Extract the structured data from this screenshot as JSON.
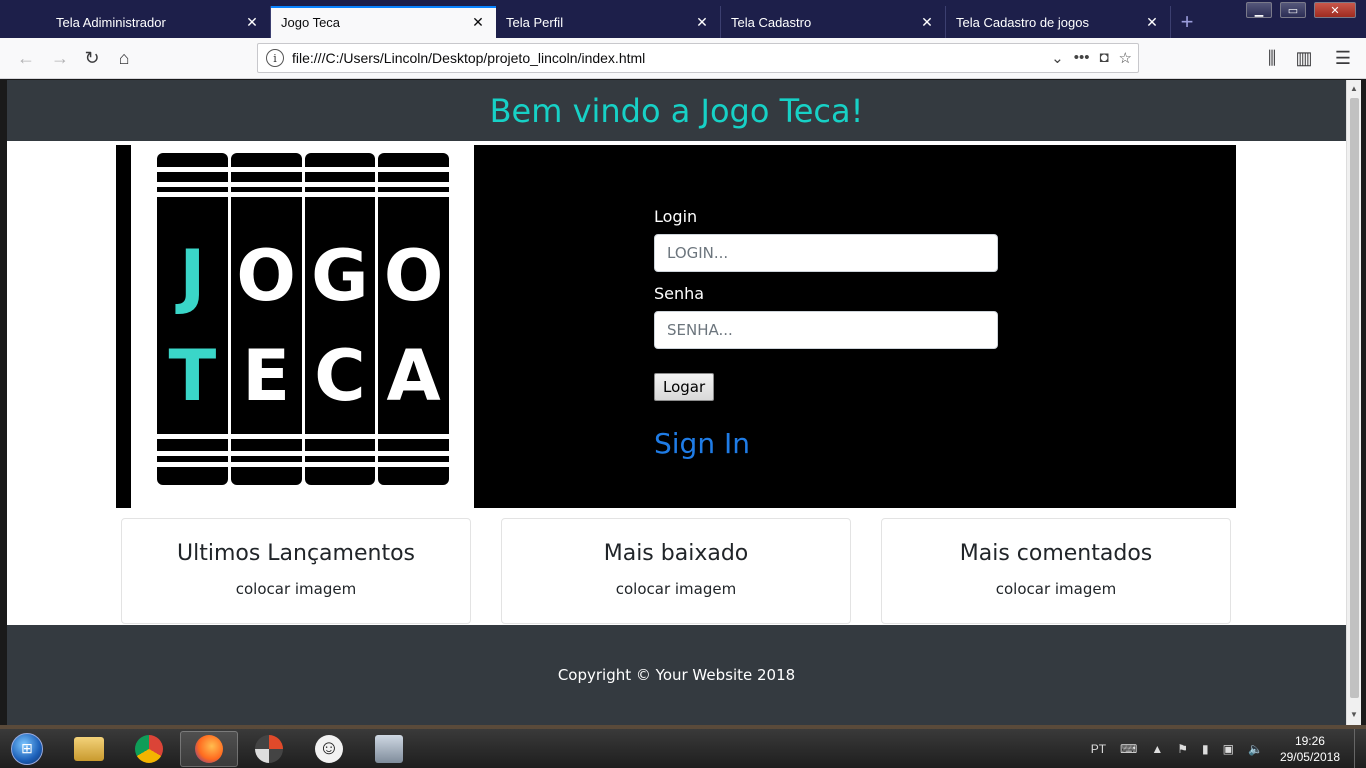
{
  "browser": {
    "tabs": [
      {
        "title": "Tela Adiministrador",
        "active": false
      },
      {
        "title": "Jogo Teca",
        "active": true
      },
      {
        "title": "Tela Perfil",
        "active": false
      },
      {
        "title": "Tela Cadastro",
        "active": false
      },
      {
        "title": "Tela Cadastro de jogos",
        "active": false
      }
    ],
    "url": "file:///C:/Users/Lincoln/Desktop/projeto_lincoln/index.html"
  },
  "page": {
    "welcome": "Bem vindo a Jogo Teca!",
    "logo_letters": [
      "J",
      "O",
      "G",
      "O",
      "T",
      "E",
      "C",
      "A"
    ],
    "login": {
      "login_label": "Login",
      "login_placeholder": "LOGIN...",
      "password_label": "Senha",
      "password_placeholder": "SENHA...",
      "button": "Logar",
      "signin_link": "Sign In"
    },
    "cards": [
      {
        "title": "Ultimos Lançamentos",
        "text": "colocar imagem"
      },
      {
        "title": "Mais baixado",
        "text": "colocar imagem"
      },
      {
        "title": "Mais comentados",
        "text": "colocar imagem"
      }
    ],
    "footer": "Copyright © Your Website 2018"
  },
  "taskbar": {
    "language": "PT",
    "time": "19:26",
    "date": "29/05/2018"
  },
  "colors": {
    "header_bg": "#343a40",
    "accent_teal": "#17d1c6",
    "link_blue": "#1f7ce6",
    "tab_bar": "#1d1f4a"
  }
}
